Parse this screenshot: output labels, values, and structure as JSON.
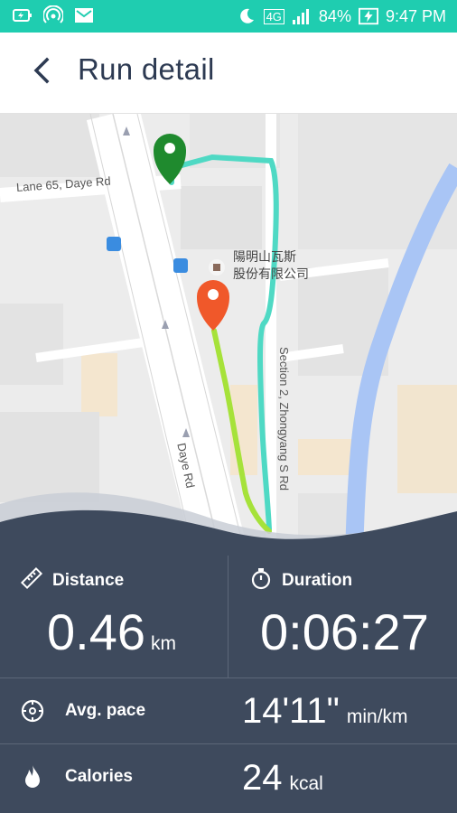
{
  "status_bar": {
    "network": "4G",
    "battery": "84%",
    "time": "9:47 PM",
    "icons": [
      "battery-saver-icon",
      "hotspot-icon",
      "mail-icon",
      "moon-icon",
      "signal-icon",
      "charging-icon"
    ]
  },
  "header": {
    "title": "Run detail",
    "back_icon": "chevron-left-icon"
  },
  "map": {
    "labels": {
      "lane": "Lane 65, Daye Rd",
      "poi_line1": "陽明山瓦斯",
      "poi_line2": "股份有限公司",
      "daye": "Daye Rd",
      "zhongyang": "Section 2, Zhongyang S Rd"
    },
    "start_marker_color": "#1f8a2e",
    "end_marker_color": "#f0582a",
    "route_colors": [
      "#4fd9c4",
      "#9fe03a"
    ]
  },
  "stats": {
    "distance": {
      "label": "Distance",
      "value": "0.46",
      "unit": "km",
      "icon": "ruler-icon"
    },
    "duration": {
      "label": "Duration",
      "value": "0:06:27",
      "icon": "stopwatch-icon"
    },
    "pace": {
      "label": "Avg. pace",
      "value": "14'11\"",
      "unit": "min/km",
      "icon": "pace-icon"
    },
    "calories": {
      "label": "Calories",
      "value": "24",
      "unit": "kcal",
      "icon": "flame-icon"
    }
  }
}
